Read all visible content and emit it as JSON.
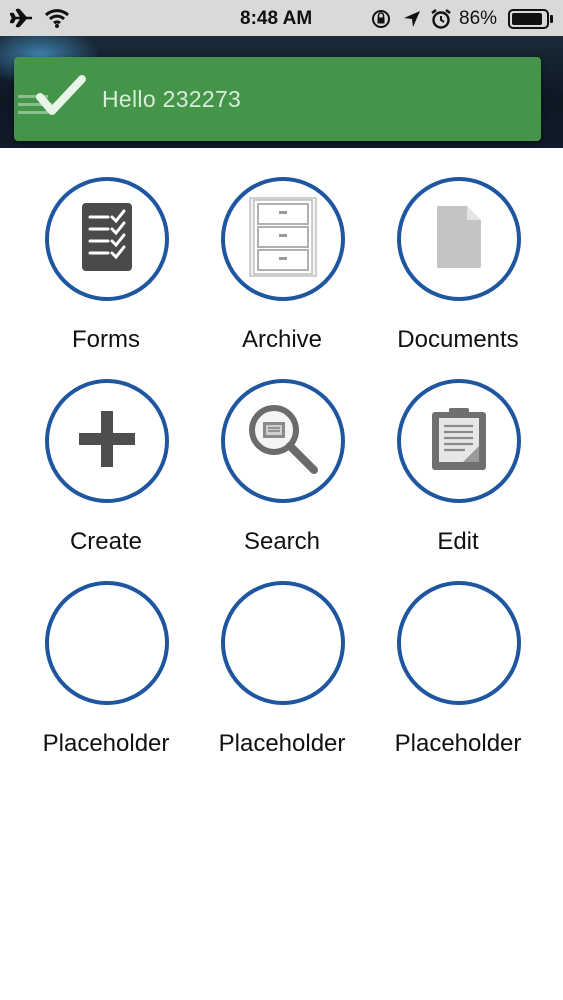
{
  "status_bar": {
    "time": "8:48 AM",
    "battery_percent": "86%",
    "icons": [
      "airplane-icon",
      "wifi-icon",
      "orientation-lock-icon",
      "location-icon",
      "alarm-icon",
      "battery-icon"
    ]
  },
  "banner": {
    "message": "Hello 232273",
    "color": "#44944a",
    "icon": "checkmark-icon"
  },
  "accent_color": "#1e56a0",
  "tiles": [
    {
      "label": "Forms",
      "icon": "forms-checklist-icon"
    },
    {
      "label": "Archive",
      "icon": "filing-cabinet-icon"
    },
    {
      "label": "Documents",
      "icon": "document-icon"
    },
    {
      "label": "Create",
      "icon": "plus-icon"
    },
    {
      "label": "Search",
      "icon": "magnifier-icon"
    },
    {
      "label": "Edit",
      "icon": "clipboard-icon"
    },
    {
      "label": "Placeholder",
      "icon": ""
    },
    {
      "label": "Placeholder",
      "icon": ""
    },
    {
      "label": "Placeholder",
      "icon": ""
    }
  ]
}
